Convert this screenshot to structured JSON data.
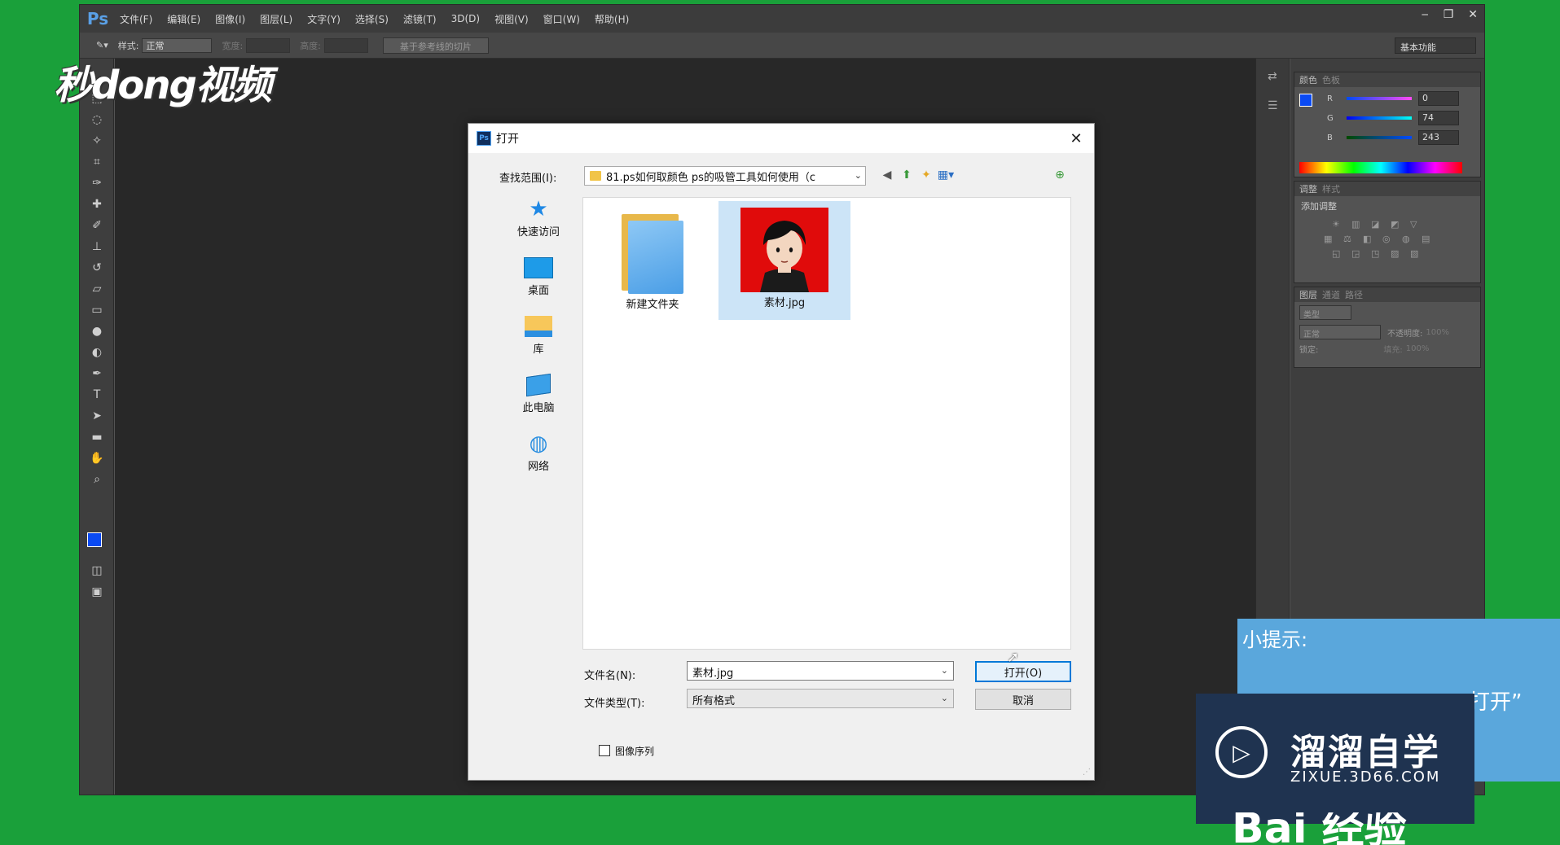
{
  "watermark": {
    "text": "秒dong视频"
  },
  "ps": {
    "logo": "Ps",
    "menu": [
      "文件(F)",
      "编辑(E)",
      "图像(I)",
      "图层(L)",
      "文字(Y)",
      "选择(S)",
      "滤镜(T)",
      "3D(D)",
      "视图(V)",
      "窗口(W)",
      "帮助(H)"
    ],
    "options": {
      "style_label": "样式:",
      "style_value": "正常",
      "width_label": "宽度:",
      "height_label": "高度:",
      "guides_button": "基于参考线的切片",
      "workspace": "基本功能"
    },
    "colors": {
      "foreground": "#0a4af3",
      "tabs": [
        "颜色",
        "色板"
      ],
      "r_label": "R",
      "r_value": "0",
      "g_label": "G",
      "g_value": "74",
      "b_label": "B",
      "b_value": "243"
    },
    "adjustments": {
      "tabs": [
        "调整",
        "样式"
      ],
      "title": "添加调整"
    },
    "layers": {
      "tabs": [
        "图层",
        "通道",
        "路径"
      ],
      "kind_label": "类型",
      "blend_mode": "正常",
      "opacity_label": "不透明度:",
      "opacity_value": "100%",
      "lock_label": "锁定:",
      "fill_label": "填充:",
      "fill_value": "100%"
    }
  },
  "dialog": {
    "title": "打开",
    "look_in_label": "查找范围(I):",
    "look_in_value": "81.ps如何取颜色 ps的吸管工具如何使用（c",
    "places": [
      "快速访问",
      "桌面",
      "库",
      "此电脑",
      "网络"
    ],
    "files": [
      {
        "name": "新建文件夹",
        "type": "folder"
      },
      {
        "name": "素材.jpg",
        "type": "image",
        "selected": true
      }
    ],
    "filename_label": "文件名(N):",
    "filename_value": "素材.jpg",
    "filetype_label": "文件类型(T):",
    "filetype_value": "所有格式",
    "open_button": "打开(O)",
    "cancel_button": "取消",
    "sequence_label": "图像序列"
  },
  "tips": {
    "title": "小提示:",
    "partial_text": "打开”"
  },
  "zixue": {
    "cn": "溜溜自学",
    "url": "ZIXUE.3D66.COM"
  },
  "baidu": {
    "text": "Bai 经验"
  }
}
